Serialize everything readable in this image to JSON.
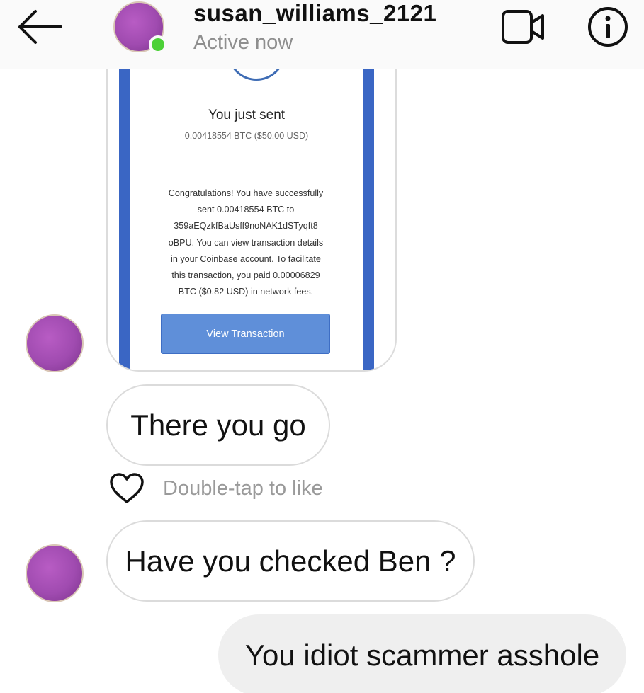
{
  "header": {
    "username": "susan_williams_2121",
    "status": "Active now"
  },
  "shared_image": {
    "title": "You just sent",
    "amount": "0.00418554 BTC ($50.00 USD)",
    "body_lines": [
      "Congratulations! You have successfully",
      "sent 0.00418554 BTC to",
      "359aEQzkfBaUsff9noNAK1dSTyqft8",
      "oBPU. You can view transaction details",
      "in your Coinbase account. To facilitate",
      "this transaction, you paid 0.00006829",
      "BTC ($0.82 USD) in network fees."
    ],
    "button_label": "View Transaction"
  },
  "messages": [
    {
      "sender": "them",
      "text": "There you go"
    },
    {
      "sender": "them",
      "text": "Have you checked Ben ?"
    },
    {
      "sender": "me",
      "text": "You idiot scammer asshole"
    }
  ],
  "like_hint": "Double-tap to like",
  "colors": {
    "online": "#4cd137",
    "card_accent": "#3a66c4",
    "button": "#5f8fd9",
    "outgoing_bubble": "#efefef"
  }
}
